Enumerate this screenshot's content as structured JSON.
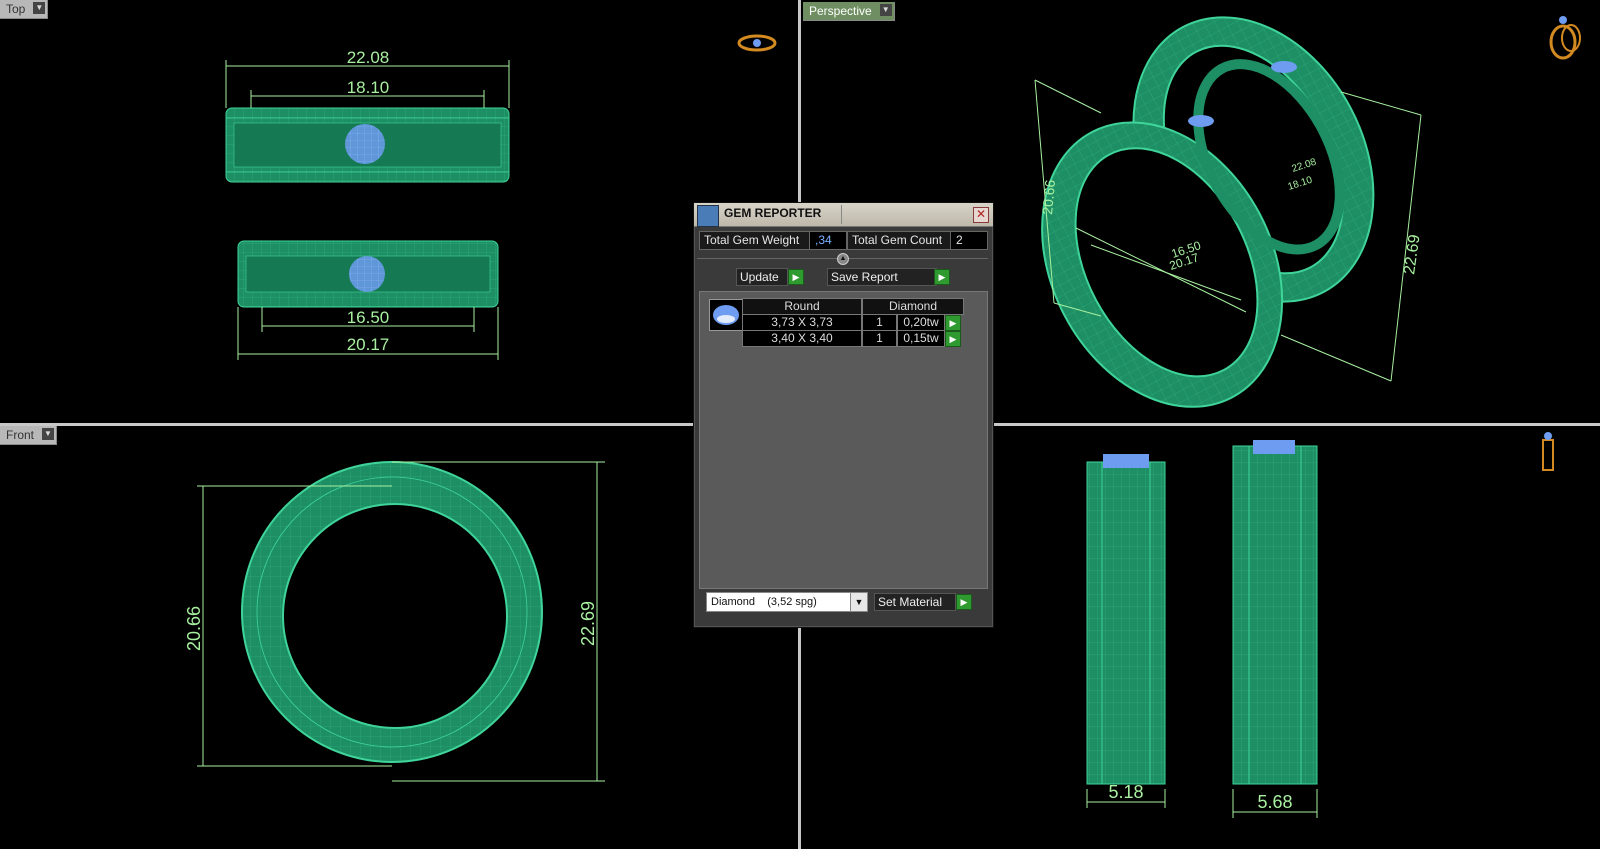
{
  "viewports": {
    "top": {
      "label": "Top",
      "dim_outer_top": "22.08",
      "dim_inner_top": "18.10",
      "dim_inner_bottom": "16.50",
      "dim_outer_bottom": "20.17"
    },
    "perspective": {
      "label": "Perspective",
      "dim_left": "20.66",
      "dim_right": "22.69",
      "dim_front_1": "20.17",
      "dim_front_2": "16.50",
      "dim_back_1": "22.08",
      "dim_back_2": "18.10"
    },
    "front": {
      "label": "Front",
      "dim_left": "20.66",
      "dim_right": "22.69"
    },
    "right": {
      "dim_width_1": "5.18",
      "dim_width_2": "5.68"
    }
  },
  "gem_reporter": {
    "title": "GEM REPORTER",
    "close": "✕",
    "total_weight_label": "Total Gem Weight",
    "total_weight_value": ",34",
    "total_count_label": "Total Gem Count",
    "total_count_value": "2",
    "update_label": "Update",
    "save_report_label": "Save Report",
    "table": {
      "headers": [
        "Round",
        "Diamond"
      ],
      "rows": [
        {
          "size": "3,73 X 3,73",
          "count": "1",
          "weight": "0,20tw"
        },
        {
          "size": "3,40 X 3,40",
          "count": "1",
          "weight": "0,15tw"
        }
      ]
    },
    "material_name": "Diamond",
    "material_density": "(3,52 spg)",
    "set_material_label": "Set Material"
  },
  "colors": {
    "ring_green": "#1e8f64",
    "wire": "#3fd49a",
    "gem": "#7aa8ff",
    "dim": "#a8f0a0"
  }
}
